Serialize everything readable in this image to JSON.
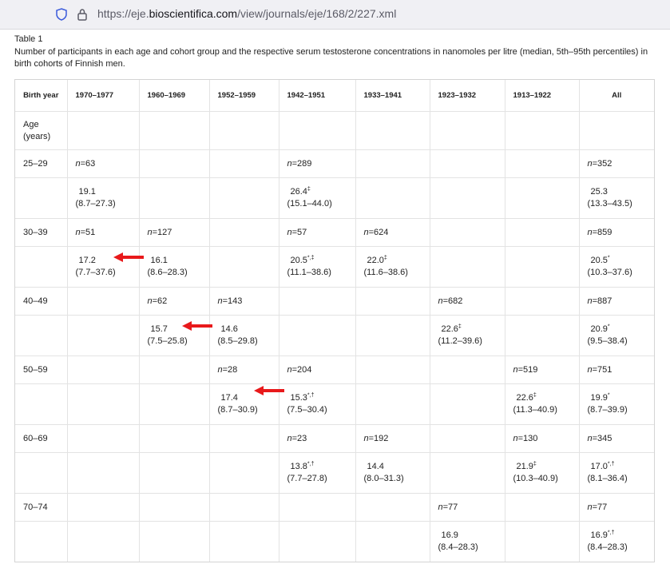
{
  "browser": {
    "url_prefix": "https://eje.",
    "url_domain": "bioscientifica.com",
    "url_path": "/view/journals/eje/168/2/227.xml"
  },
  "table": {
    "title": "Table 1",
    "caption": "Number of participants in each age and cohort group and the respective serum testosterone concentrations in nanomoles per litre (median, 5th–95th percentiles) in birth cohorts of Finnish men.",
    "header": [
      "Birth year",
      "1970–1977",
      "1960–1969",
      "1952–1959",
      "1942–1951",
      "1933–1941",
      "1923–1932",
      "1913–1922",
      "All"
    ],
    "age_header": "Age (years)",
    "rows": [
      {
        "age": "25–29",
        "n": [
          "n=63",
          "",
          "",
          "n=289",
          "",
          "",
          "",
          "n=352"
        ],
        "v": [
          [
            "19.1",
            "",
            "(8.7–27.3)"
          ],
          null,
          null,
          [
            "26.4",
            "‡",
            "(15.1–44.0)"
          ],
          null,
          null,
          null,
          [
            "25.3",
            "",
            "(13.3–43.5)"
          ]
        ]
      },
      {
        "age": "30–39",
        "n": [
          "n=51",
          "n=127",
          "",
          "n=57",
          "n=624",
          "",
          "",
          "n=859"
        ],
        "v": [
          [
            "17.2",
            "",
            "(7.7–37.6)"
          ],
          [
            "16.1",
            "",
            "(8.6–28.3)"
          ],
          null,
          [
            "20.5",
            "*,‡",
            "(11.1–38.6)"
          ],
          [
            "22.0",
            "‡",
            "(11.6–38.6)"
          ],
          null,
          null,
          [
            "20.5",
            "*",
            "(10.3–37.6)"
          ]
        ]
      },
      {
        "age": "40–49",
        "n": [
          "",
          "n=62",
          "n=143",
          "",
          "",
          "n=682",
          "",
          "n=887"
        ],
        "v": [
          null,
          [
            "15.7",
            "",
            "(7.5–25.8)"
          ],
          [
            "14.6",
            "",
            "(8.5–29.8)"
          ],
          null,
          null,
          [
            "22.6",
            "‡",
            "(11.2–39.6)"
          ],
          null,
          [
            "20.9",
            "*",
            "(9.5–38.4)"
          ]
        ]
      },
      {
        "age": "50–59",
        "n": [
          "",
          "",
          "n=28",
          "n=204",
          "",
          "",
          "n=519",
          "n=751"
        ],
        "v": [
          null,
          null,
          [
            "17.4",
            "",
            "(8.7–30.9)"
          ],
          [
            "15.3",
            "*,†",
            "(7.5–30.4)"
          ],
          null,
          null,
          [
            "22.6",
            "‡",
            "(11.3–40.9)"
          ],
          [
            "19.9",
            "*",
            "(8.7–39.9)"
          ]
        ]
      },
      {
        "age": "60–69",
        "n": [
          "",
          "",
          "",
          "n=23",
          "n=192",
          "",
          "n=130",
          "n=345"
        ],
        "v": [
          null,
          null,
          null,
          [
            "13.8",
            "*,†",
            "(7.7–27.8)"
          ],
          [
            "14.4",
            "",
            "(8.0–31.3)"
          ],
          null,
          [
            "21.9",
            "‡",
            "(10.3–40.9)"
          ],
          [
            "17.0",
            "*,†",
            "(8.1–36.4)"
          ]
        ]
      },
      {
        "age": "70–74",
        "n": [
          "",
          "",
          "",
          "",
          "",
          "n=77",
          "",
          "n=77"
        ],
        "v": [
          null,
          null,
          null,
          null,
          null,
          [
            "16.9",
            "",
            "(8.4–28.3)"
          ],
          null,
          [
            "16.9",
            "*,†",
            "(8.4–28.3)"
          ]
        ]
      }
    ]
  },
  "annotation_color": "#e8191b"
}
